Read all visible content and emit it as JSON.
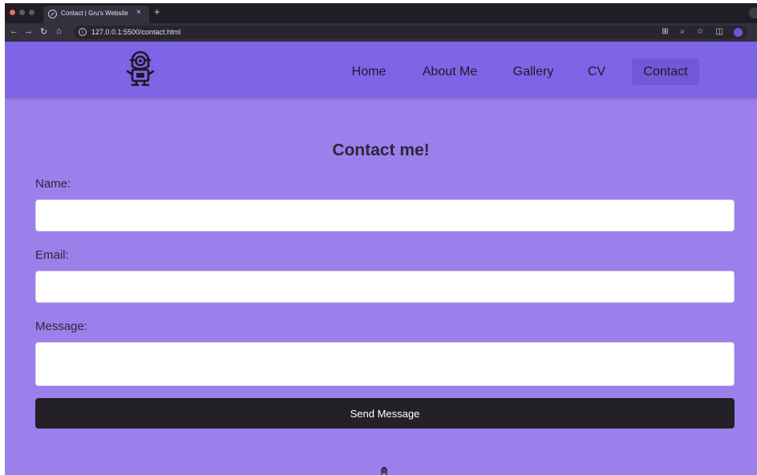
{
  "browser": {
    "tab_title": "Contact | Gru's Website",
    "tab_close": "×",
    "new_tab": "+",
    "url": "127.0.0.1:5500/contact.html",
    "nav_back": "←",
    "nav_forward": "→",
    "reload": "↻",
    "home": "⌂",
    "omnibox_icons": "⊞ ⌕ ☆ ◫"
  },
  "site": {
    "logo_icon": "minion-icon",
    "nav": {
      "home": "Home",
      "about": "About Me",
      "gallery": "Gallery",
      "cv": "CV",
      "contact": "Contact"
    },
    "active_nav": "Contact"
  },
  "contact": {
    "heading": "Contact me!",
    "name_label": "Name:",
    "name_value": "",
    "email_label": "Email:",
    "email_value": "",
    "message_label": "Message:",
    "message_value": "",
    "send_label": "Send Message"
  },
  "colors": {
    "page_bg": "#9b80ec",
    "header_bg": "#7e64e6",
    "active_nav_bg": "#7158d6",
    "button_bg": "#232127"
  }
}
